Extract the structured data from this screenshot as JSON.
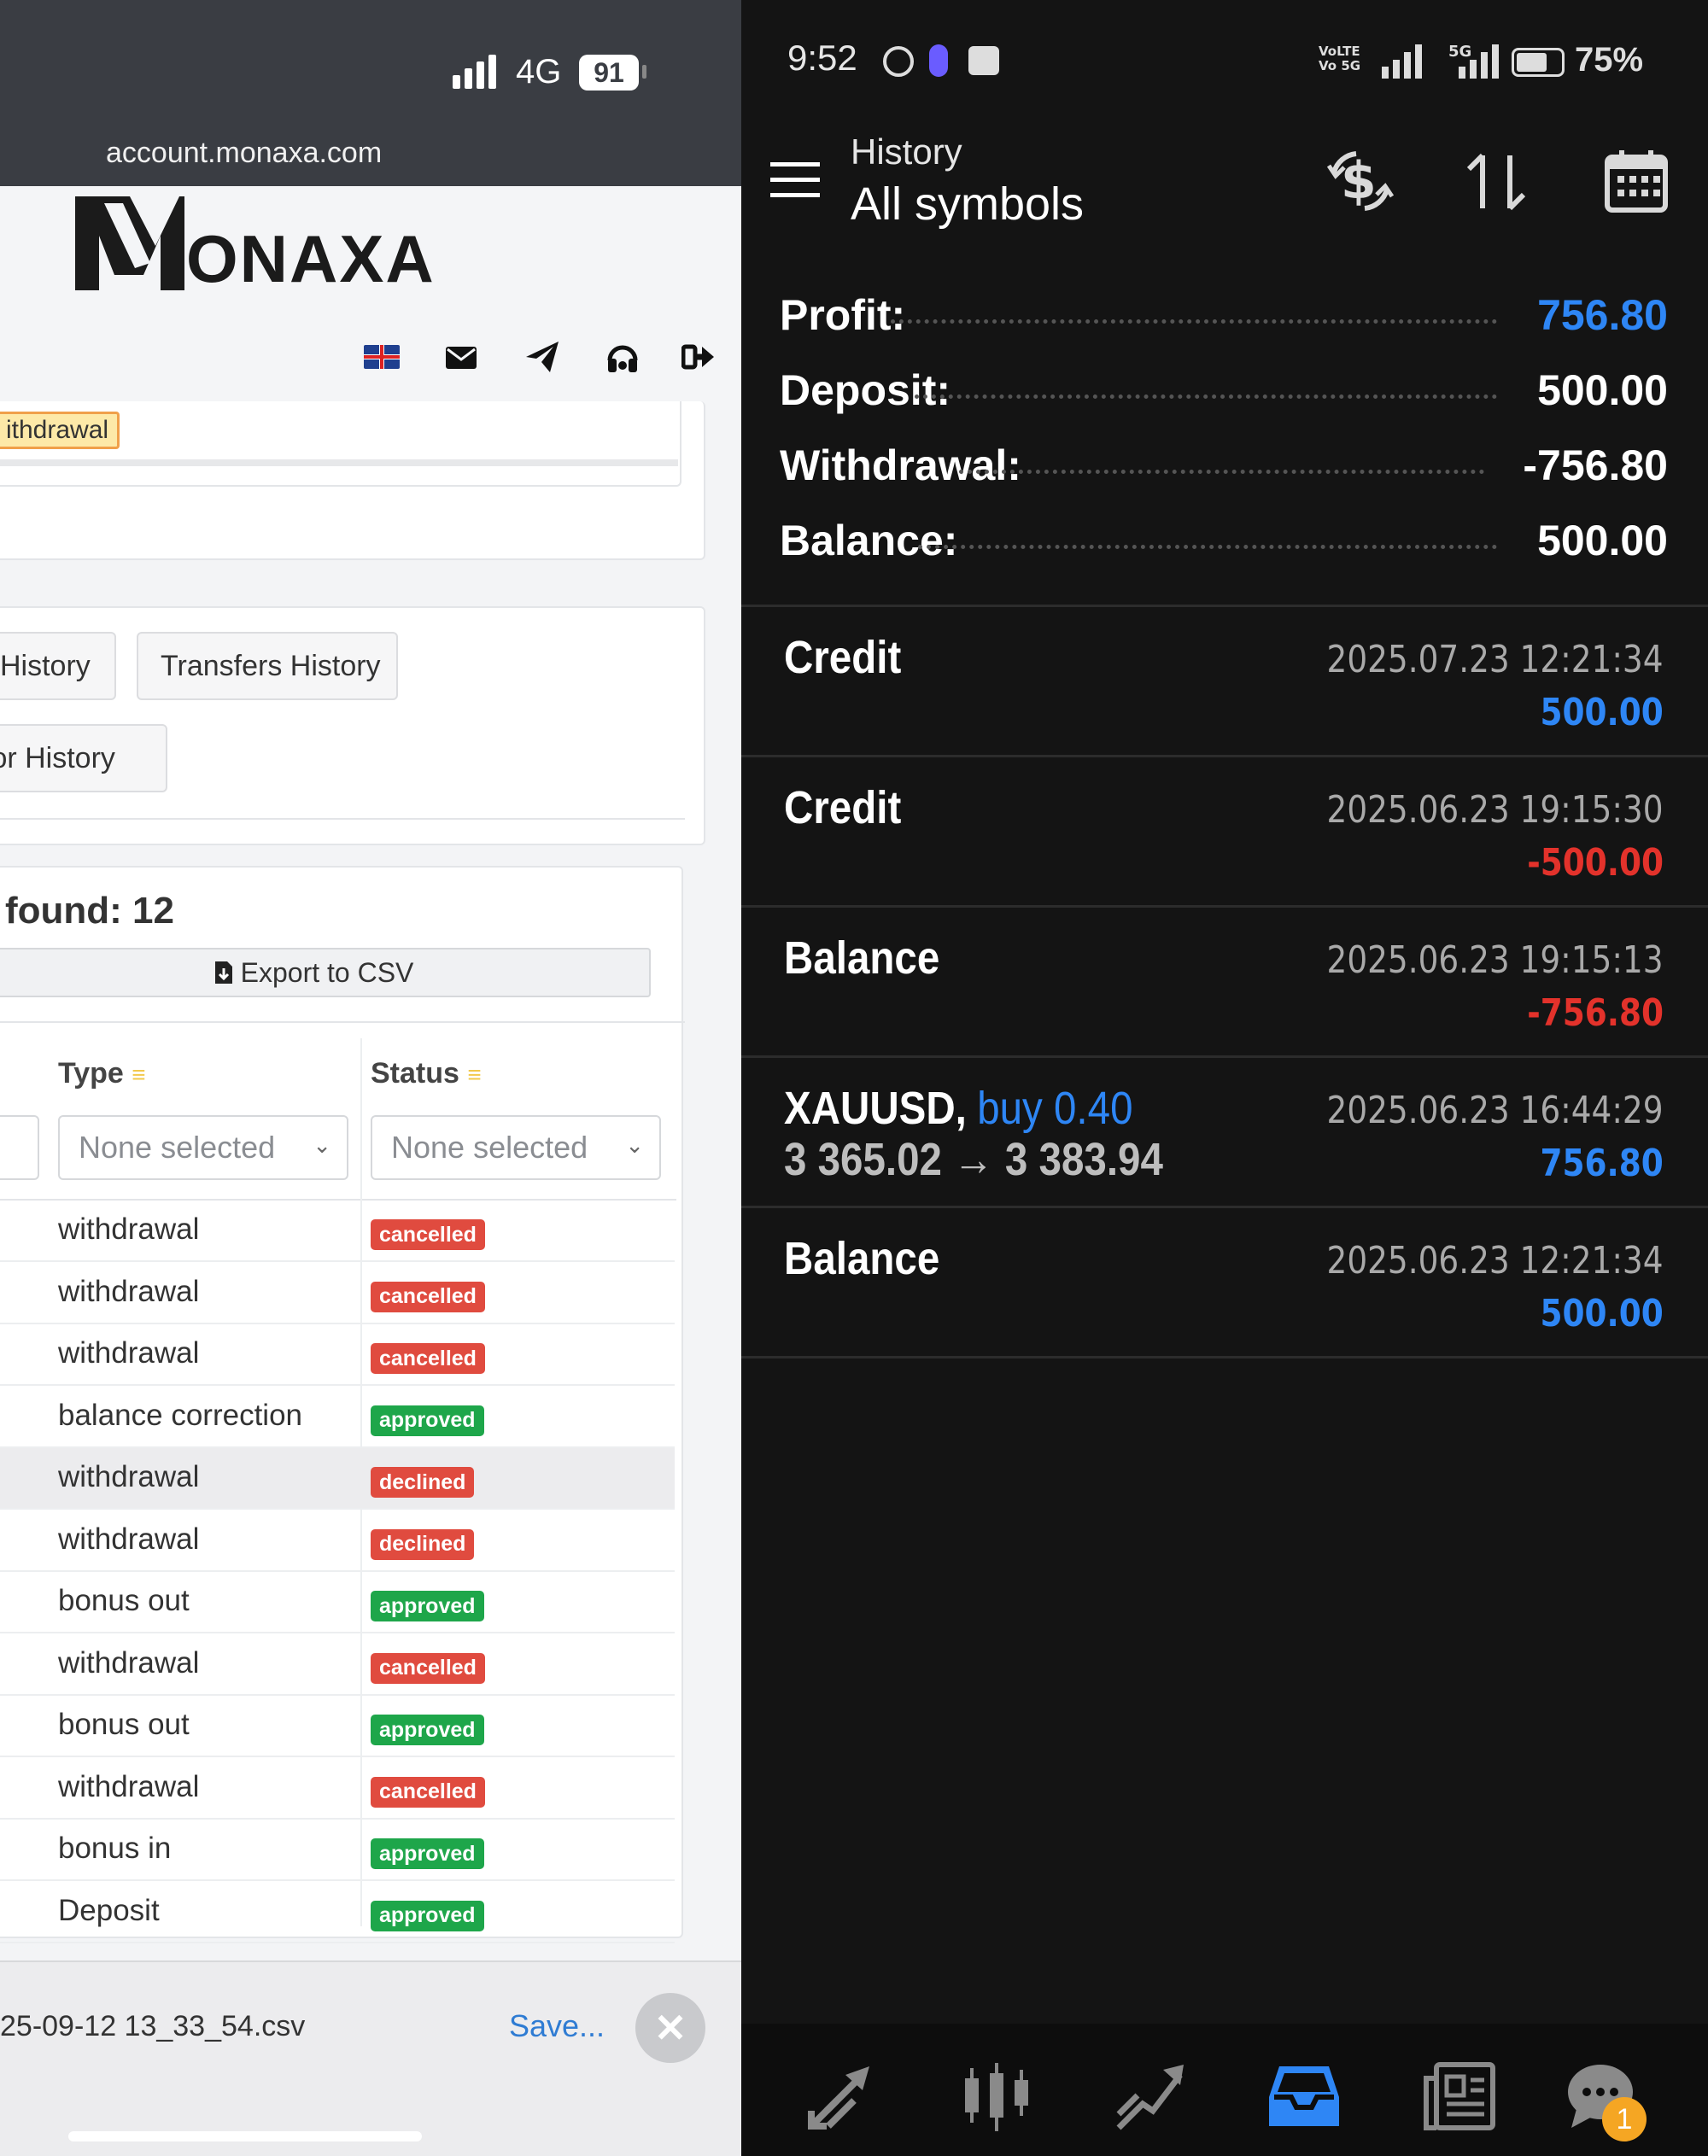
{
  "left": {
    "status": {
      "signal_text": "4G",
      "battery": "91"
    },
    "url": "account.monaxa.com",
    "logo_text": "ONAXA",
    "partial_badge": "ithdrawal",
    "tabs": [
      {
        "label": "History"
      },
      {
        "label": "Transfers History"
      },
      {
        "label": "tor History"
      }
    ],
    "found_label": "found: 12",
    "export_label": "Export to CSV",
    "columns": {
      "type": "Type",
      "status": "Status"
    },
    "filters": {
      "type_placeholder": "None selected",
      "status_placeholder": "None selected"
    },
    "rows": [
      {
        "type": "withdrawal",
        "status": "cancelled",
        "color": "#e04b3f"
      },
      {
        "type": "withdrawal",
        "status": "cancelled",
        "color": "#e04b3f"
      },
      {
        "type": "withdrawal",
        "status": "cancelled",
        "color": "#e04b3f"
      },
      {
        "type": "balance correction",
        "status": "approved",
        "color": "#1ea64a"
      },
      {
        "type": "withdrawal",
        "status": "declined",
        "color": "#e04b3f"
      },
      {
        "type": "withdrawal",
        "status": "declined",
        "color": "#e04b3f"
      },
      {
        "type": "bonus out",
        "status": "approved",
        "color": "#1ea64a"
      },
      {
        "type": "withdrawal",
        "status": "cancelled",
        "color": "#e04b3f"
      },
      {
        "type": "bonus out",
        "status": "approved",
        "color": "#1ea64a"
      },
      {
        "type": "withdrawal",
        "status": "cancelled",
        "color": "#e04b3f"
      },
      {
        "type": "bonus in",
        "status": "approved",
        "color": "#1ea64a"
      },
      {
        "type": "Deposit",
        "status": "approved",
        "color": "#1ea64a"
      }
    ],
    "download": {
      "filename": "25-09-12 13_33_54.csv",
      "save_label": "Save..."
    }
  },
  "right": {
    "status": {
      "time": "9:52",
      "battery": "75%",
      "net_labels": [
        "VoLTE",
        "Vo 5G",
        "5G"
      ]
    },
    "header": {
      "title": "History",
      "subtitle": "All symbols"
    },
    "summary": [
      {
        "label": "Profit:",
        "value": "756.80",
        "color": "#2e86f5"
      },
      {
        "label": "Deposit:",
        "value": "500.00",
        "color": "#ffffff"
      },
      {
        "label": "Withdrawal:",
        "value": "-756.80",
        "color": "#ffffff"
      },
      {
        "label": "Balance:",
        "value": "500.00",
        "color": "#ffffff"
      }
    ],
    "deals": [
      {
        "name": "Credit",
        "date": "2025.07.23 12:21:34",
        "amount": "500.00",
        "color": "#2e86f5"
      },
      {
        "name": "Credit",
        "date": "2025.06.23 19:15:30",
        "amount": "-500.00",
        "color": "#e3322b"
      },
      {
        "name": "Balance",
        "date": "2025.06.23 19:15:13",
        "amount": "-756.80",
        "color": "#e3322b"
      },
      {
        "name": "XAUUSD,",
        "side": "buy 0.40",
        "prices": "3 365.02 → 3 383.94",
        "date": "2025.06.23 16:44:29",
        "amount": "756.80",
        "color": "#2e86f5"
      },
      {
        "name": "Balance",
        "date": "2025.06.23 12:21:34",
        "amount": "500.00",
        "color": "#2e86f5"
      }
    ],
    "nav": {
      "chat_badge": "1",
      "accent": "#2e86f5"
    }
  }
}
